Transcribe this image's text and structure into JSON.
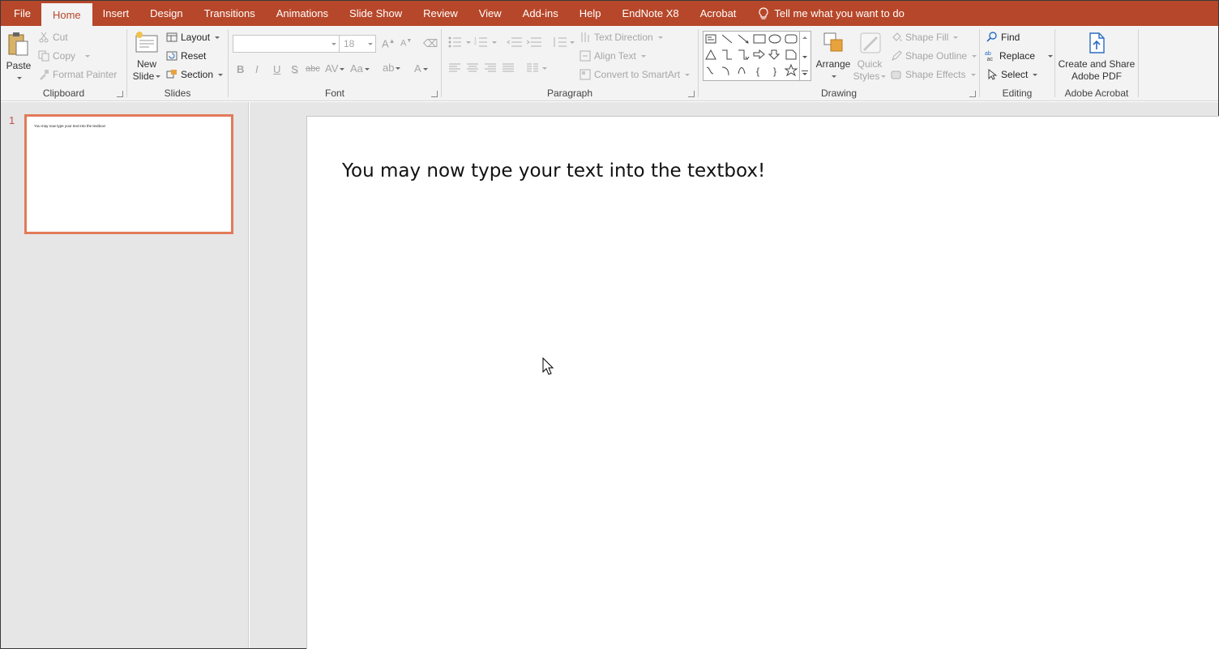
{
  "tabs": [
    "File",
    "Home",
    "Insert",
    "Design",
    "Transitions",
    "Animations",
    "Slide Show",
    "Review",
    "View",
    "Add-ins",
    "Help",
    "EndNote X8",
    "Acrobat"
  ],
  "active_tab": "Home",
  "tell_me": "Tell me what you want to do",
  "clipboard": {
    "paste": "Paste",
    "cut": "Cut",
    "copy": "Copy",
    "format_painter": "Format Painter",
    "label": "Clipboard"
  },
  "slides_group": {
    "new_slide_1": "New",
    "new_slide_2": "Slide",
    "layout": "Layout",
    "reset": "Reset",
    "section": "Section",
    "label": "Slides"
  },
  "font": {
    "font_name": "",
    "font_size": "18",
    "label": "Font",
    "bold": "B",
    "italic": "I",
    "underline": "U",
    "shadow": "S",
    "strike": "abc",
    "spacing": "AV",
    "case": "Aa",
    "color": "A"
  },
  "paragraph": {
    "text_direction": "Text Direction",
    "align_text": "Align Text",
    "smartart": "Convert to SmartArt",
    "label": "Paragraph"
  },
  "drawing": {
    "arrange": "Arrange",
    "quick_styles_1": "Quick",
    "quick_styles_2": "Styles",
    "shape_fill": "Shape Fill",
    "shape_outline": "Shape Outline",
    "shape_effects": "Shape Effects",
    "label": "Drawing"
  },
  "editing": {
    "find": "Find",
    "replace": "Replace",
    "select": "Select",
    "label": "Editing"
  },
  "acrobat": {
    "create_1": "Create and Share",
    "create_2": "Adobe PDF",
    "label": "Adobe Acrobat"
  },
  "slide_panel": {
    "slide_number": "1",
    "thumb_text": "You may now type your text into the textbox!"
  },
  "slide": {
    "text": "You may now type your text into the textbox!"
  },
  "colors": {
    "accent": "#b7472a",
    "thumb_border": "#e27a5a"
  }
}
